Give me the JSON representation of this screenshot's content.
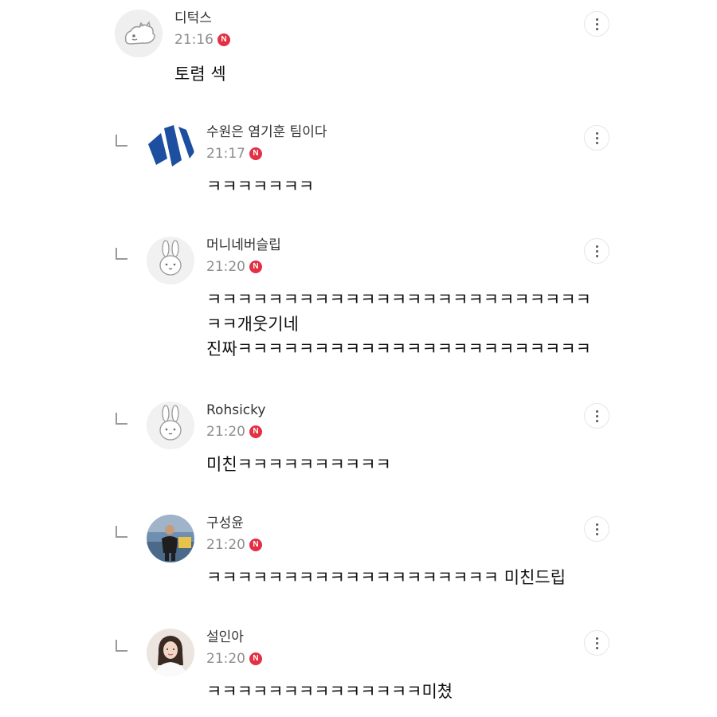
{
  "comments": [
    {
      "author": "디턱스",
      "time": "21:16",
      "badge": "N",
      "lines": [
        "토렴 섹"
      ],
      "avatar_icon": "dinosaur-avatar-icon",
      "is_reply": false
    },
    {
      "author": "수원은 염기훈 팀이다",
      "time": "21:17",
      "badge": "N",
      "lines": [
        "ㅋㅋㅋㅋㅋㅋㅋ"
      ],
      "avatar_icon": "blue-stripes-avatar-icon",
      "is_reply": true
    },
    {
      "author": "머니네버슬립",
      "time": "21:20",
      "badge": "N",
      "lines": [
        "ㅋㅋㅋㅋㅋㅋㅋㅋㅋㅋㅋㅋㅋㅋㅋㅋㅋㅋㅋㅋㅋㅋㅋㅋㅋ",
        "ㅋㅋ개웃기네",
        "진짜ㅋㅋㅋㅋㅋㅋㅋㅋㅋㅋㅋㅋㅋㅋㅋㅋㅋㅋㅋㅋㅋㅋㅋ"
      ],
      "avatar_icon": "bunny-avatar-icon",
      "is_reply": true
    },
    {
      "author": "Rohsicky",
      "time": "21:20",
      "badge": "N",
      "lines": [
        "미친ㅋㅋㅋㅋㅋㅋㅋㅋㅋㅋ"
      ],
      "avatar_icon": "bunny-avatar-icon",
      "is_reply": true
    },
    {
      "author": "구성윤",
      "time": "21:20",
      "badge": "N",
      "lines": [
        "ㅋㅋㅋㅋㅋㅋㅋㅋㅋㅋㅋㅋㅋㅋㅋㅋㅋㅋㅋ 미친드립"
      ],
      "avatar_icon": "goalkeeper-photo-avatar-icon",
      "is_reply": true
    },
    {
      "author": "설인아",
      "time": "21:20",
      "badge": "N",
      "lines": [
        "ㅋㅋㅋㅋㅋㅋㅋㅋㅋㅋㅋㅋㅋㅋ미쳤"
      ],
      "avatar_icon": "woman-photo-avatar-icon",
      "is_reply": true
    }
  ],
  "colors": {
    "badge": "#e33045",
    "timestamp": "#8e8e8e",
    "author": "#333333"
  }
}
